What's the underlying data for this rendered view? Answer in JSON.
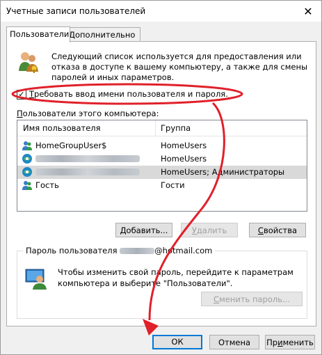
{
  "window": {
    "title": "Учетные записи пользователей",
    "close_glyph": "✕"
  },
  "tabs": [
    {
      "label": "Пользователи",
      "active": true
    },
    {
      "label": "Дополнительно",
      "active": false
    }
  ],
  "description": "Следующий список используется для предоставления или отказа в доступе к вашему компьютеру, а также для смены паролей и иных параметров.",
  "require_login": {
    "checked": true,
    "mark": "✓",
    "label_underlined": "Т",
    "label_rest": "ребовать ввод имени пользователя и пароля."
  },
  "users_list": {
    "label_underlined": "П",
    "label_rest": "ользователи этого компьютера:",
    "columns": {
      "name": "Имя пользователя",
      "group": "Группа"
    },
    "rows": [
      {
        "name": "HomeGroupUser$",
        "group": "HomeUsers"
      },
      {
        "name": "",
        "group": "HomeUsers"
      },
      {
        "name": "",
        "group": "HomeUsers; Администраторы"
      },
      {
        "name": "Гость",
        "group": "Гости"
      }
    ]
  },
  "buttons": {
    "add_underlined": "Д",
    "add_rest": "обавить...",
    "remove_underlined": "У",
    "remove_rest": "далить",
    "properties_underlined": "С",
    "properties_rest": "войства"
  },
  "password_group": {
    "title_prefix": "Пароль пользователя",
    "title_suffix": "@hotmail.com",
    "text": "Чтобы изменить свой пароль, перейдите к параметрам компьютера и выберите \"Пользователи\".",
    "change_underlined": "С",
    "change_rest": "менить пароль..."
  },
  "footer": {
    "ok_label": "ОК",
    "cancel_label": "Отмена",
    "apply_prefix": "Пр",
    "apply_underlined": "и",
    "apply_suffix": "менить"
  },
  "colors": {
    "annotation_red": "#e0202a",
    "default_focus": "#0078d7"
  }
}
